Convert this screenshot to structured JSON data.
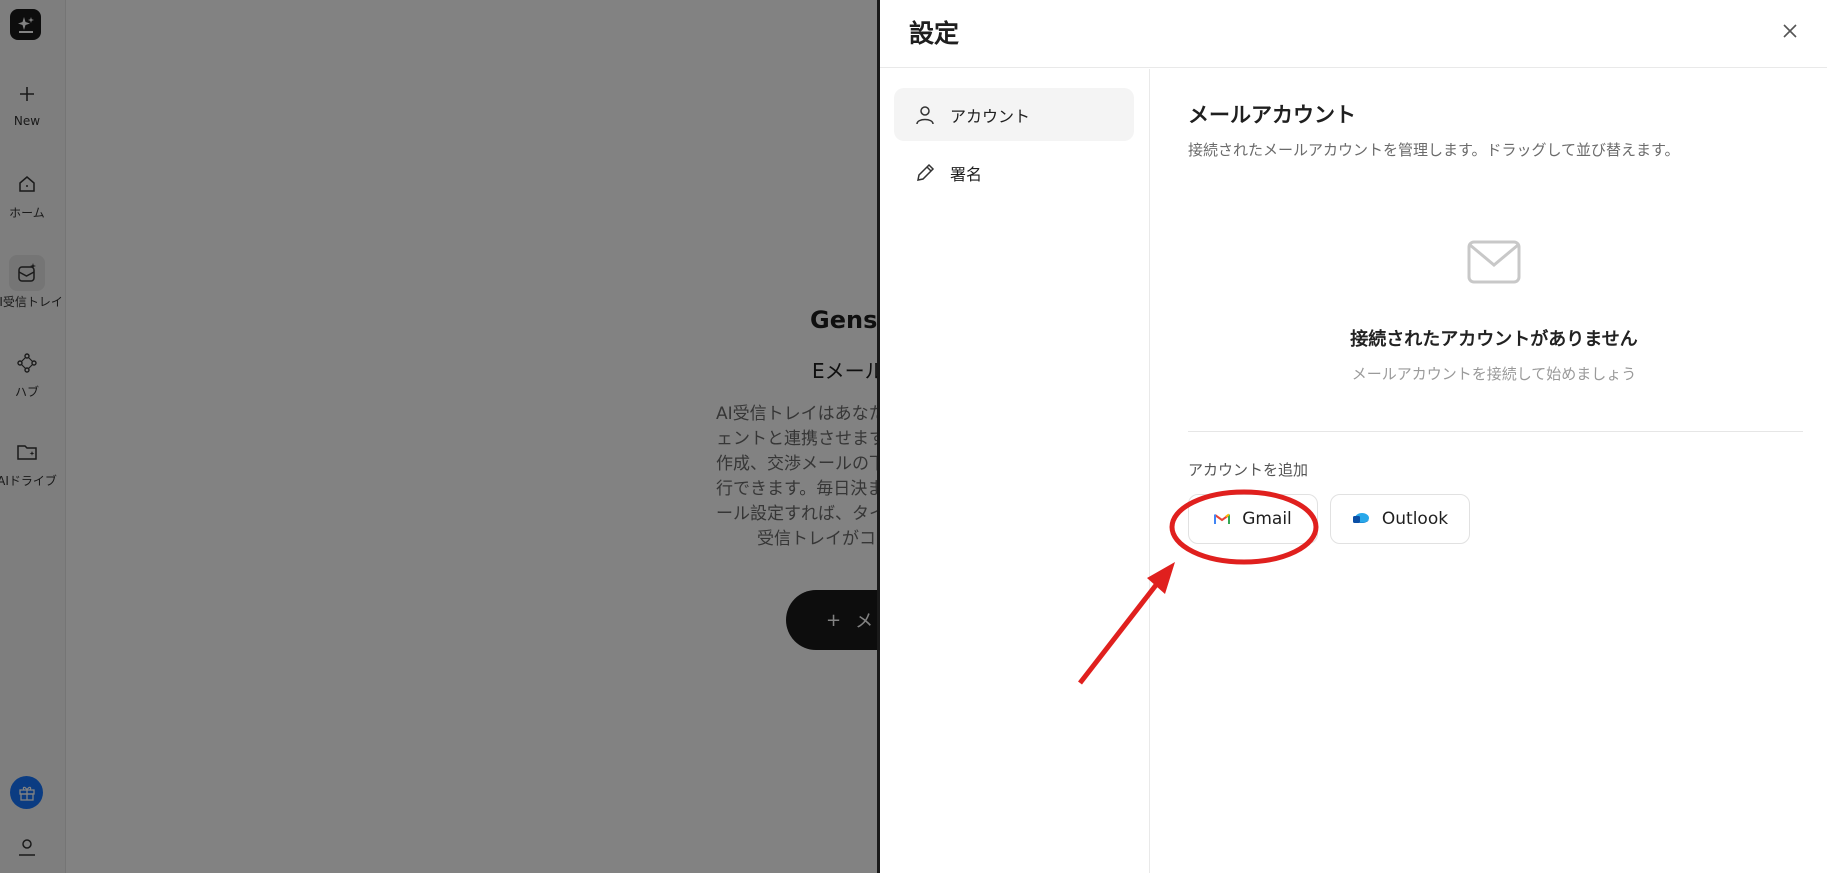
{
  "rail": {
    "items": [
      {
        "label": "New",
        "icon": "plus-icon"
      },
      {
        "label": "ホーム",
        "icon": "home-icon"
      },
      {
        "label": "AI受信トレイ",
        "icon": "ai-inbox-icon"
      },
      {
        "label": "ハブ",
        "icon": "hub-icon"
      },
      {
        "label": "AIドライブ",
        "icon": "ai-drive-icon"
      }
    ]
  },
  "background": {
    "title": "Gensp",
    "subtitle": "Eメール",
    "description": [
      "AI受信トレイはあなた",
      "ェントと連携させます",
      "作成、交渉メールの下",
      "行できます。毎日決ま",
      "ール設定すれば、タイ",
      "受信トレイがコ"
    ],
    "cta_plus": "+",
    "cta_label": "メ"
  },
  "panel": {
    "title": "設定",
    "nav": [
      {
        "label": "アカウント",
        "icon": "user-icon",
        "active": true
      },
      {
        "label": "署名",
        "icon": "pencil-icon",
        "active": false
      }
    ],
    "section_title": "メールアカウント",
    "section_desc": "接続されたメールアカウントを管理します。ドラッグして並び替えます。",
    "empty_title": "接続されたアカウントがありません",
    "empty_desc": "メールアカウントを接続して始めましょう",
    "add_label": "アカウントを追加",
    "providers": [
      {
        "label": "Gmail",
        "icon": "gmail-icon"
      },
      {
        "label": "Outlook",
        "icon": "outlook-icon"
      }
    ]
  },
  "colors": {
    "accent_dark": "#1a1a1a",
    "annotation_red": "#e0201e",
    "gift_blue": "#1677ff"
  }
}
